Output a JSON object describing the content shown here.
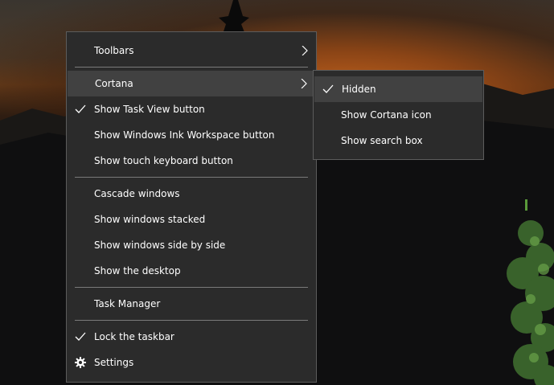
{
  "context_menu": {
    "items": [
      {
        "label": "Toolbars",
        "has_submenu": true
      },
      {
        "label": "Cortana",
        "has_submenu": true,
        "highlighted": true
      },
      {
        "label": "Show Task View button",
        "checked": true
      },
      {
        "label": "Show Windows Ink Workspace button"
      },
      {
        "label": "Show touch keyboard button"
      },
      {
        "label": "Cascade windows"
      },
      {
        "label": "Show windows stacked"
      },
      {
        "label": "Show windows side by side"
      },
      {
        "label": "Show the desktop"
      },
      {
        "label": "Task Manager"
      },
      {
        "label": "Lock the taskbar",
        "checked": true
      },
      {
        "label": "Settings",
        "icon": "gear-icon"
      }
    ]
  },
  "cortana_submenu": {
    "items": [
      {
        "label": "Hidden",
        "checked": true,
        "highlighted": true
      },
      {
        "label": "Show Cortana icon"
      },
      {
        "label": "Show search box"
      }
    ]
  },
  "colors": {
    "menu_background": "#2b2b2b",
    "highlight": "#414141",
    "text": "#ffffff",
    "separator": "#7a7a7a"
  }
}
